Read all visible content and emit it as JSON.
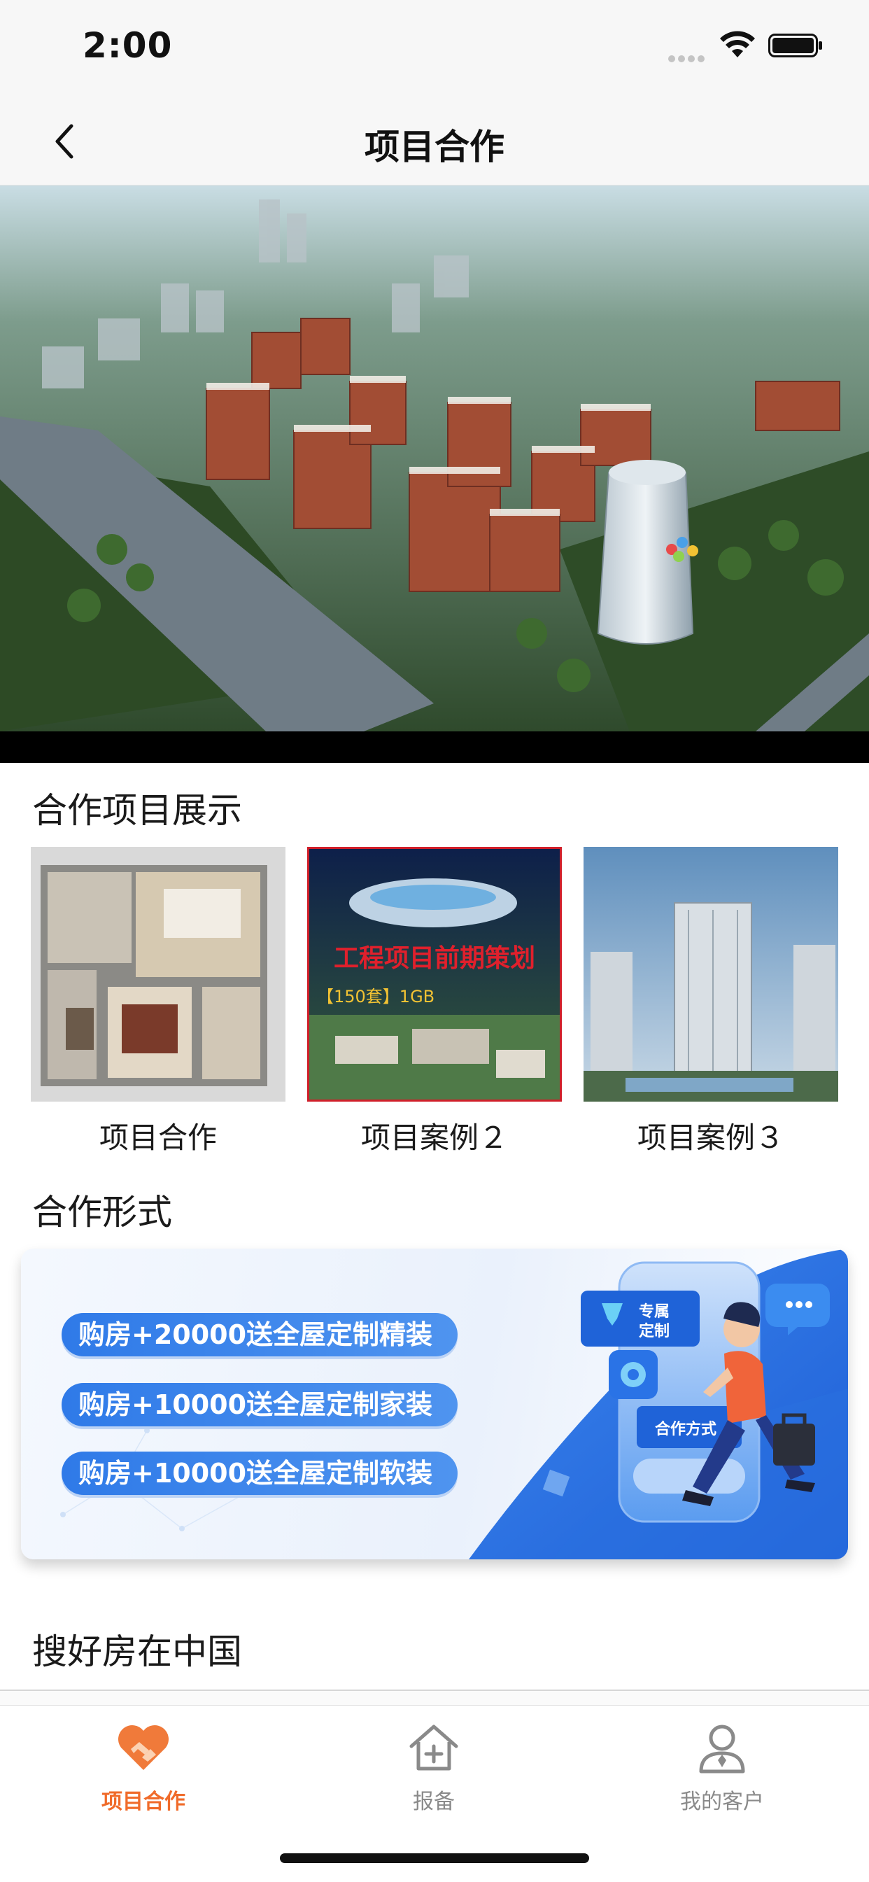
{
  "status_bar": {
    "time": "2:00"
  },
  "nav": {
    "title": "项目合作"
  },
  "banner": {
    "slide_count": 2,
    "active_index": 1
  },
  "sections": {
    "projects_title": "合作项目展示",
    "cooperation_title": "合作形式",
    "brand_title": "搜好房在中国"
  },
  "projects": [
    {
      "label": "项目合作",
      "icon": "floor-plan-image"
    },
    {
      "label": "项目案例２",
      "icon": "engineering-planning-image",
      "overlay_title": "工程项目前期策划",
      "overlay_sub": "【150套】1GB"
    },
    {
      "label": "项目案例３",
      "icon": "highrise-building-image"
    }
  ],
  "cooperation": {
    "offers": [
      "购房+20000送全屋定制精装",
      "购房+10000送全屋定制家装",
      "购房+10000送全屋定制软装"
    ],
    "badge_line1": "专属",
    "badge_line2": "定制",
    "panel_label": "合作方式"
  },
  "tabs": [
    {
      "label": "项目合作",
      "icon": "handshake-heart-icon",
      "active": true
    },
    {
      "label": "报备",
      "icon": "house-plus-icon",
      "active": false
    },
    {
      "label": "我的客户",
      "icon": "user-icon",
      "active": false
    }
  ],
  "colors": {
    "accent": "#f06b2a",
    "pill_blue": "#2f7ae8",
    "dot_active": "#f2b233"
  }
}
